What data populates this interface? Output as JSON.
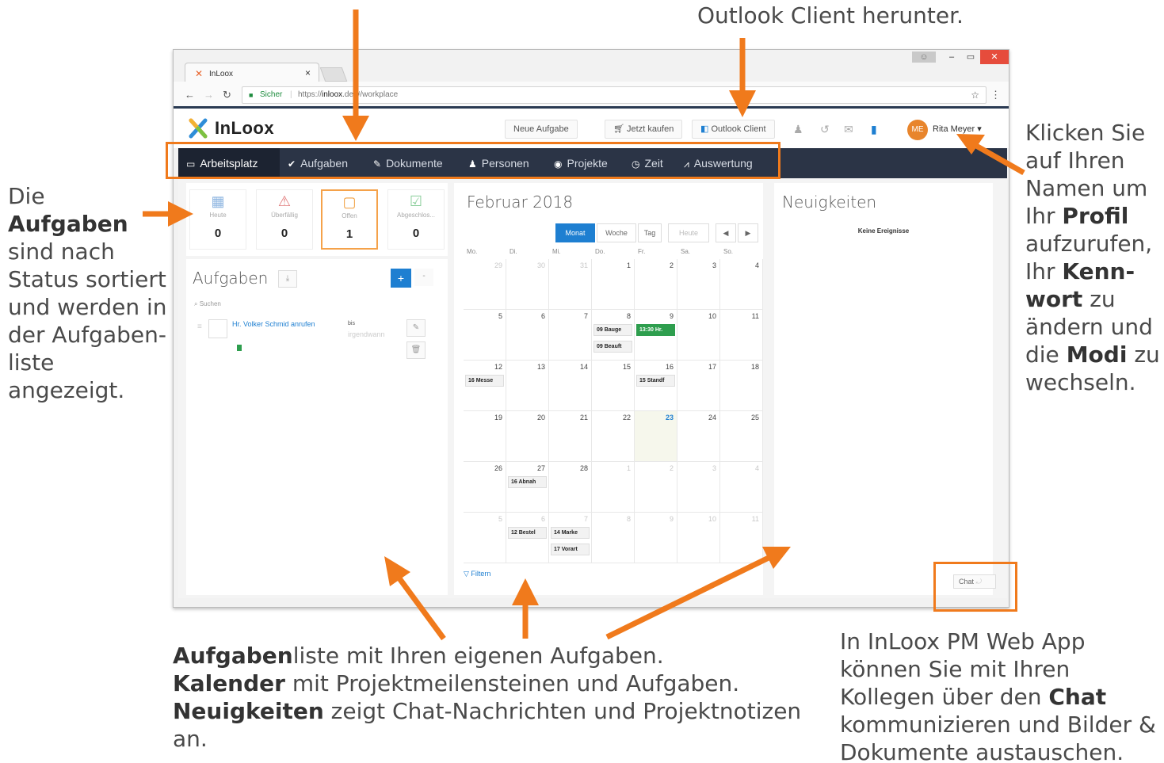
{
  "annotations": {
    "top_right": "Outlook Client herunter.",
    "left_parts": [
      "Die ",
      "Aufgaben",
      " sind nach Status sortiert und  werden in der Aufgaben-liste angezeigt."
    ],
    "right_parts": [
      "Klicken Sie auf Ihren Namen um Ihr ",
      "Profil",
      " aufzurufen, Ihr ",
      "Kenn-wort",
      " zu ändern und die ",
      "Modi",
      " zu wechseln."
    ],
    "bottom_line1": [
      "Aufgaben",
      "liste mit Ihren eigenen Aufgaben."
    ],
    "bottom_line2": [
      "Kalender",
      " mit Projektmeilensteinen und Aufgaben."
    ],
    "bottom_line3": [
      "Neuigkeiten",
      " zeigt Chat-Nachrichten und Projektnotizen an."
    ],
    "bottom_right": [
      "In InLoox PM Web App können Sie mit Ihren Kollegen über den ",
      "Chat",
      " kommunizieren und Bilder & Dokumente austauschen."
    ]
  },
  "browser": {
    "tab_title": "InLoox",
    "tab_close": "×",
    "secure_label": "Sicher",
    "url_prefix": "https://",
    "url_host": "inloox",
    "url_rest": ".de/#/workplace"
  },
  "header": {
    "logo": "InLoox",
    "buttons": {
      "new_task": "Neue Aufgabe",
      "buy_now": "Jetzt kaufen",
      "outlook_client": "Outlook Client"
    },
    "user": {
      "initials": "ME",
      "name": "Rita Meyer ▾"
    }
  },
  "nav": {
    "items": [
      {
        "label": "Arbeitsplatz",
        "icon": "▭"
      },
      {
        "label": "Aufgaben",
        "icon": "✔"
      },
      {
        "label": "Dokumente",
        "icon": "✎"
      },
      {
        "label": "Personen",
        "icon": "♟"
      },
      {
        "label": "Projekte",
        "icon": "◉"
      },
      {
        "label": "Zeit",
        "icon": "◷"
      },
      {
        "label": "Auswertung",
        "icon": "⩘"
      }
    ]
  },
  "tasks": {
    "stats": [
      {
        "label": "Heute",
        "count": "0",
        "icon": "▦",
        "color": "#8cb4e0"
      },
      {
        "label": "Überfällig",
        "count": "0",
        "icon": "⚠",
        "color": "#e07b7b"
      },
      {
        "label": "Offen",
        "count": "1",
        "icon": "▢",
        "color": "#f0a040"
      },
      {
        "label": "Abgeschlos...",
        "count": "0",
        "icon": "☑",
        "color": "#8ccf9c"
      }
    ],
    "title": "Aufgaben",
    "search_placeholder": "Suchen",
    "task": {
      "name": "Hr. Volker Schmid anrufen",
      "due_label": "bis",
      "due_value": "irgendwann"
    },
    "filter_label": "Filtern"
  },
  "calendar": {
    "title": "Februar 2018",
    "views": [
      "Monat",
      "Woche",
      "Tag"
    ],
    "today_label": "Heute",
    "weekdays": [
      "Mo.",
      "Di.",
      "Mi.",
      "Do.",
      "Fr.",
      "Sa.",
      "So."
    ],
    "weeks": [
      [
        "29",
        "30",
        "31",
        "1",
        "2",
        "3",
        "4"
      ],
      [
        "5",
        "6",
        "7",
        "8",
        "9",
        "10",
        "11"
      ],
      [
        "12",
        "13",
        "14",
        "15",
        "16",
        "17",
        "18"
      ],
      [
        "19",
        "20",
        "21",
        "22",
        "23",
        "24",
        "25"
      ],
      [
        "26",
        "27",
        "28",
        "1",
        "2",
        "3",
        "4"
      ],
      [
        "5",
        "6",
        "7",
        "8",
        "9",
        "10",
        "11"
      ]
    ],
    "events": [
      {
        "week": 1,
        "day": 3,
        "slot": 0,
        "text": "09 Bauge"
      },
      {
        "week": 1,
        "day": 3,
        "slot": 1,
        "text": "09 Beauft"
      },
      {
        "week": 1,
        "day": 4,
        "slot": 0,
        "text": "13:30 Hr.",
        "style": "green"
      },
      {
        "week": 2,
        "day": 0,
        "slot": 0,
        "text": "16 Messe"
      },
      {
        "week": 2,
        "day": 4,
        "slot": 0,
        "text": "15 Standf"
      },
      {
        "week": 4,
        "day": 1,
        "slot": 0,
        "text": "16 Abnah"
      },
      {
        "week": 5,
        "day": 1,
        "slot": 0,
        "text": "12 Bestel"
      },
      {
        "week": 5,
        "day": 2,
        "slot": 0,
        "text": "14 Marke"
      },
      {
        "week": 5,
        "day": 2,
        "slot": 1,
        "text": "17 Vorart"
      }
    ]
  },
  "news": {
    "title": "Neuigkeiten",
    "empty": "Keine Ereignisse"
  },
  "chat": {
    "label": "Chat"
  },
  "colors": {
    "accent_orange": "#f07a1c",
    "nav_dark": "#2b3446",
    "primary_blue": "#1e7fd1"
  }
}
